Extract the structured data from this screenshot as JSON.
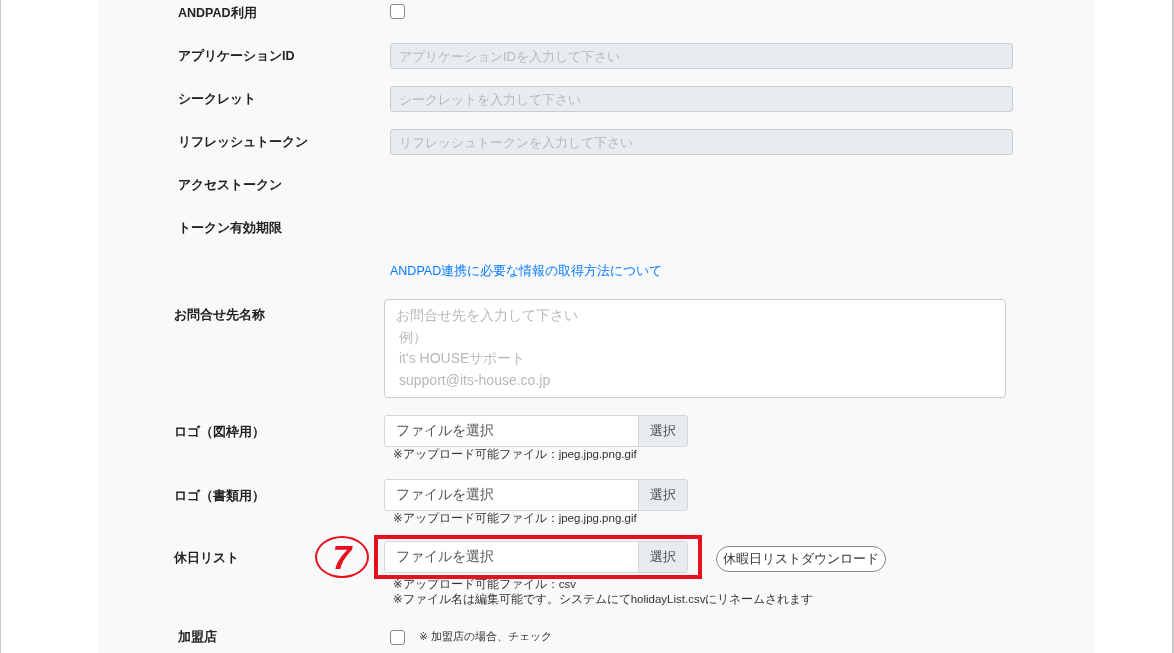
{
  "rows": [
    {
      "kind": "checkbox",
      "label": "ANDPAD利用",
      "checked": false
    },
    {
      "kind": "text",
      "label": "アプリケーションID",
      "placeholder": "アプリケーションIDを入力して下さい",
      "disabled": true
    },
    {
      "kind": "text",
      "label": "シークレット",
      "placeholder": "シークレットを入力して下さい",
      "disabled": true
    },
    {
      "kind": "text",
      "label": "リフレッシュトークン",
      "placeholder": "リフレッシュトークンを入力して下さい",
      "disabled": true
    },
    {
      "kind": "plain",
      "label": "アクセストークン"
    },
    {
      "kind": "plain",
      "label": "トークン有効期限"
    },
    {
      "kind": "link",
      "link": "ANDPAD連携に必要な情報の取得方法について"
    },
    {
      "kind": "textarea",
      "label": "お問合せ先名称",
      "placeholder": [
        "お問合せ先を入力して下さい",
        "例）",
        "it's HOUSEサポート",
        "support@its-house.co.jp"
      ]
    },
    {
      "kind": "file",
      "label": "ロゴ（図枠用）",
      "placeholder": "ファイルを選択",
      "button": "選択",
      "notes": [
        "※アップロード可能ファイル：jpeg.jpg.png.gif"
      ]
    },
    {
      "kind": "file",
      "label": "ロゴ（書類用）",
      "placeholder": "ファイルを選択",
      "button": "選択",
      "notes": [
        "※アップロード可能ファイル：jpeg.jpg.png.gif"
      ]
    },
    {
      "kind": "file",
      "label": "休日リスト",
      "placeholder": "ファイルを選択",
      "button": "選択",
      "notes": [
        "※アップロード可能ファイル：csv",
        "※ファイル名は編集可能です。システムにてholidayList.csvにリネームされます"
      ],
      "extra_button": "休暇日リストダウンロード",
      "annotation": "7"
    },
    {
      "kind": "checkbox",
      "label": "加盟店",
      "checked": false,
      "note": "※ 加盟店の場合、チェック"
    }
  ]
}
